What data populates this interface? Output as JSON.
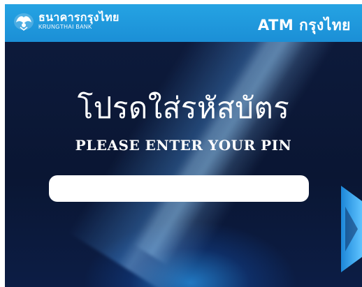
{
  "header": {
    "bank_name_thai": "ธนาคารกรุงไทย",
    "bank_name_en": "KRUNGTHAI BANK",
    "title": "ATM กรุงไทย"
  },
  "prompt": {
    "thai": "โปรดใส่รหัสบัตร",
    "english": "PLEASE ENTER YOUR PIN"
  },
  "pin_field": {
    "value": ""
  },
  "icons": {
    "logo": "krungthai-bird-logo-icon",
    "side": "arrow-right-icon"
  },
  "colors": {
    "header": "#1b8fd6",
    "background": "#0b1530",
    "accent": "#2896eb"
  }
}
